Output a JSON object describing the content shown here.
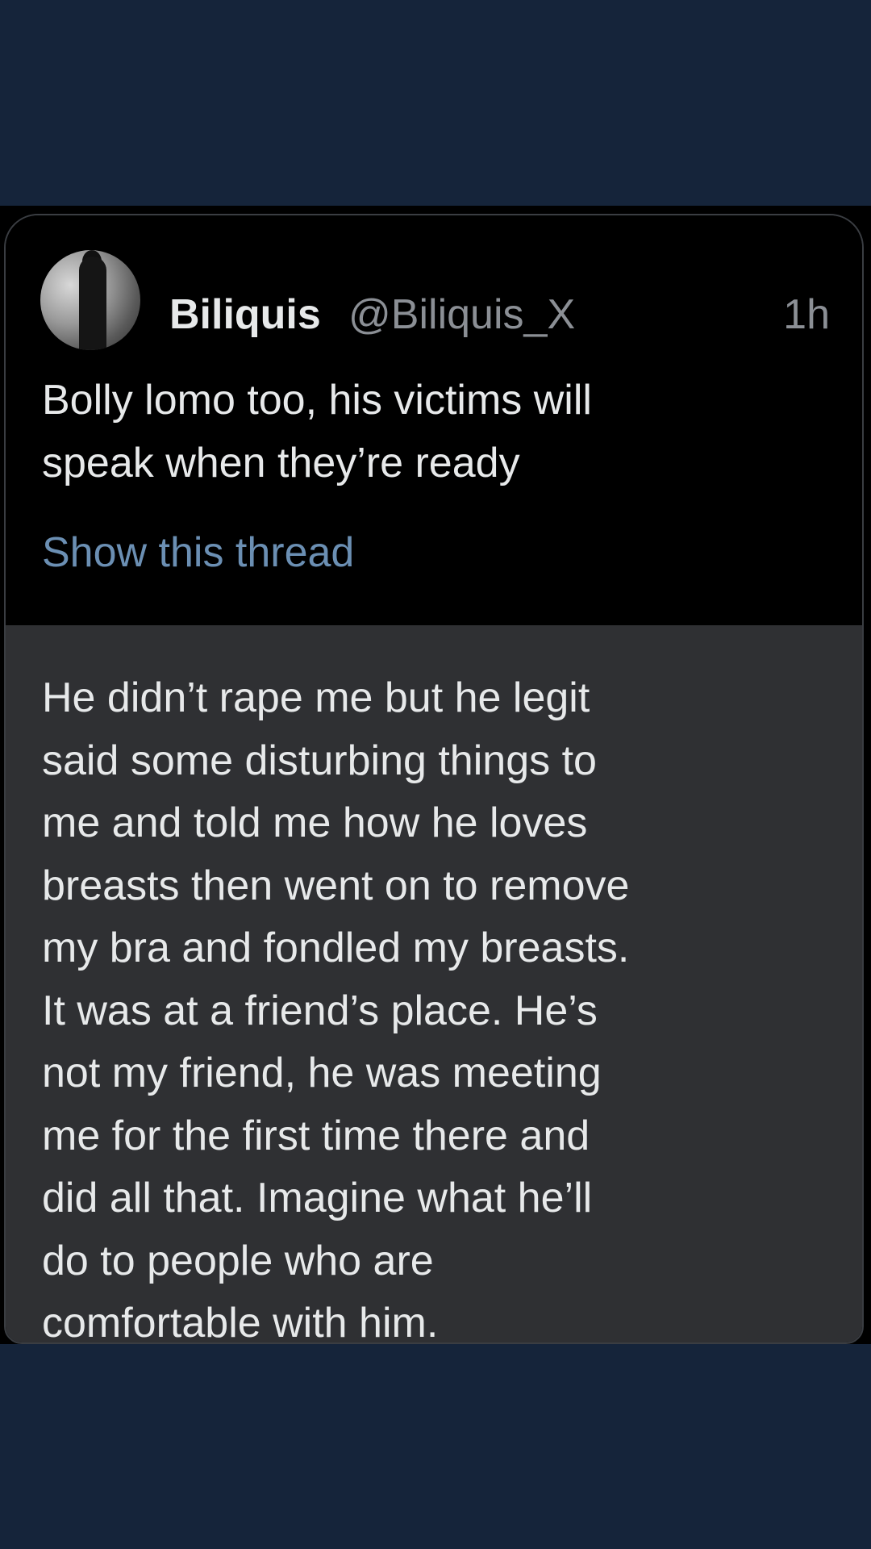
{
  "quoted_tweet": {
    "author_name": "Biliquis",
    "author_handle": "@Biliquis_X",
    "timestamp": "1h",
    "text": "Bolly lomo too, his victims will\nspeak when they’re ready",
    "show_thread_label": "Show this thread"
  },
  "reply_tweet": {
    "text": "He didn’t rape me but he legit\nsaid some disturbing things to\nme and told me how he loves\nbreasts then went on to remove\nmy bra and fondled my breasts.\nIt was at a friend’s place. He’s\nnot my friend, he was meeting\nme for the first time there and\ndid all that. Imagine what he’ll\ndo to people who are\ncomfortable with him."
  },
  "colors": {
    "outer_background": "#15243a",
    "card_background": "#000000",
    "reply_background": "#2f3033",
    "link": "#6b8fb3",
    "primary_text": "#e7e9ea",
    "secondary_text": "#8b8f95"
  },
  "icons": {
    "avatar": "profile-photo"
  }
}
